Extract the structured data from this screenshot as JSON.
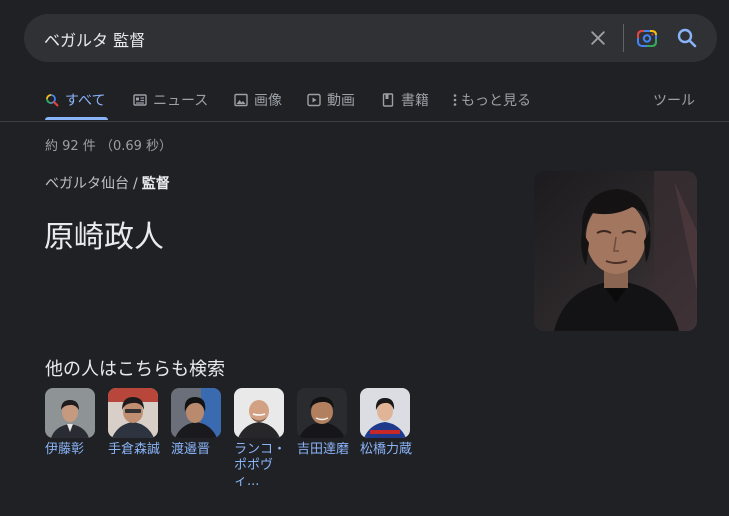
{
  "search": {
    "query": "ベガルタ 監督"
  },
  "tabs": [
    {
      "label": "すべて",
      "icon": "search-icon",
      "active": true
    },
    {
      "label": "ニュース",
      "icon": "news-icon"
    },
    {
      "label": "画像",
      "icon": "image-icon"
    },
    {
      "label": "動画",
      "icon": "video-icon"
    },
    {
      "label": "書籍",
      "icon": "book-icon"
    },
    {
      "label": "もっと見る",
      "icon": "more-vert-icon"
    }
  ],
  "tools_label": "ツール",
  "result_stats": "約 92 件 （0.69 秒）",
  "breadcrumb": {
    "parent": "ベガルタ仙台",
    "separator": "/",
    "current": "監督"
  },
  "answer": "原崎政人",
  "related": {
    "title": "他の人はこちらも検索",
    "people": [
      {
        "name": "伊藤彰"
      },
      {
        "name": "手倉森誠"
      },
      {
        "name": "渡邉晋"
      },
      {
        "name": "ランコ・ポポヴィ..."
      },
      {
        "name": "吉田達磨"
      },
      {
        "name": "松橋力蔵"
      }
    ]
  },
  "colors": {
    "background": "#202124",
    "search_bar": "#303134",
    "link": "#8ab4f8",
    "text_primary": "#e8eaed",
    "text_secondary": "#9aa0a6"
  }
}
